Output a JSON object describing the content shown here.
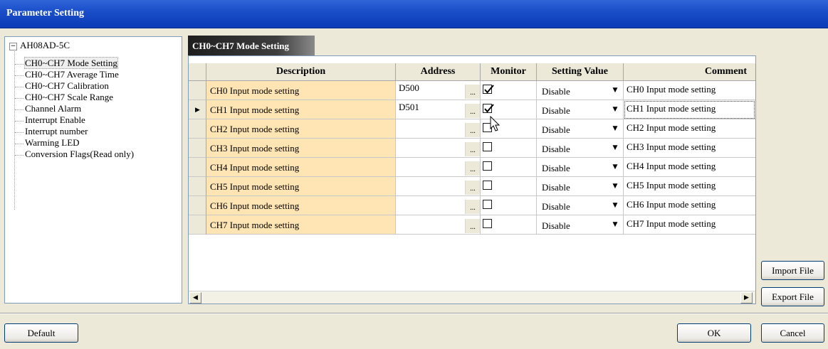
{
  "window": {
    "title": "Parameter Setting"
  },
  "tree": {
    "root": "AH08AD-5C",
    "items": [
      {
        "label": "CH0~CH7 Mode Setting",
        "selected": true
      },
      {
        "label": "CH0~CH7 Average Time"
      },
      {
        "label": "CH0~CH7 Calibration"
      },
      {
        "label": "CH0~CH7 Scale Range"
      },
      {
        "label": "Channel Alarm"
      },
      {
        "label": "Interrupt Enable"
      },
      {
        "label": "Interrupt number"
      },
      {
        "label": "Warming LED"
      },
      {
        "label": "Conversion Flags(Read only)"
      }
    ]
  },
  "panel": {
    "title": "CH0~CH7 Mode Setting"
  },
  "grid": {
    "columns": [
      "Description",
      "Address",
      "Monitor",
      "Setting Value",
      "Comment"
    ],
    "rows": [
      {
        "description": "CH0 Input mode setting",
        "address": "D500",
        "monitor": true,
        "setting": "Disable",
        "comment": "CH0 Input mode setting"
      },
      {
        "description": "CH1 Input mode setting",
        "address": "D501",
        "monitor": true,
        "setting": "Disable",
        "comment": "CH1 Input mode setting",
        "current": true
      },
      {
        "description": "CH2 Input mode setting",
        "address": "",
        "monitor": false,
        "setting": "Disable",
        "comment": "CH2 Input mode setting"
      },
      {
        "description": "CH3 Input mode setting",
        "address": "",
        "monitor": false,
        "setting": "Disable",
        "comment": "CH3 Input mode setting"
      },
      {
        "description": "CH4 Input mode setting",
        "address": "",
        "monitor": false,
        "setting": "Disable",
        "comment": "CH4 Input mode setting"
      },
      {
        "description": "CH5 Input mode setting",
        "address": "",
        "monitor": false,
        "setting": "Disable",
        "comment": "CH5 Input mode setting"
      },
      {
        "description": "CH6 Input mode setting",
        "address": "",
        "monitor": false,
        "setting": "Disable",
        "comment": "CH6 Input mode setting"
      },
      {
        "description": "CH7 Input mode setting",
        "address": "",
        "monitor": false,
        "setting": "Disable",
        "comment": "CH7 Input mode setting"
      }
    ],
    "ellipsis": "...",
    "dropdown_icon": "chevron-down-icon"
  },
  "buttons": {
    "import": "Import File",
    "export": "Export File",
    "default": "Default",
    "ok": "OK",
    "cancel": "Cancel"
  },
  "colors": {
    "description_bg": "#ffe5b4",
    "title_bar": "#1a4fc9"
  }
}
